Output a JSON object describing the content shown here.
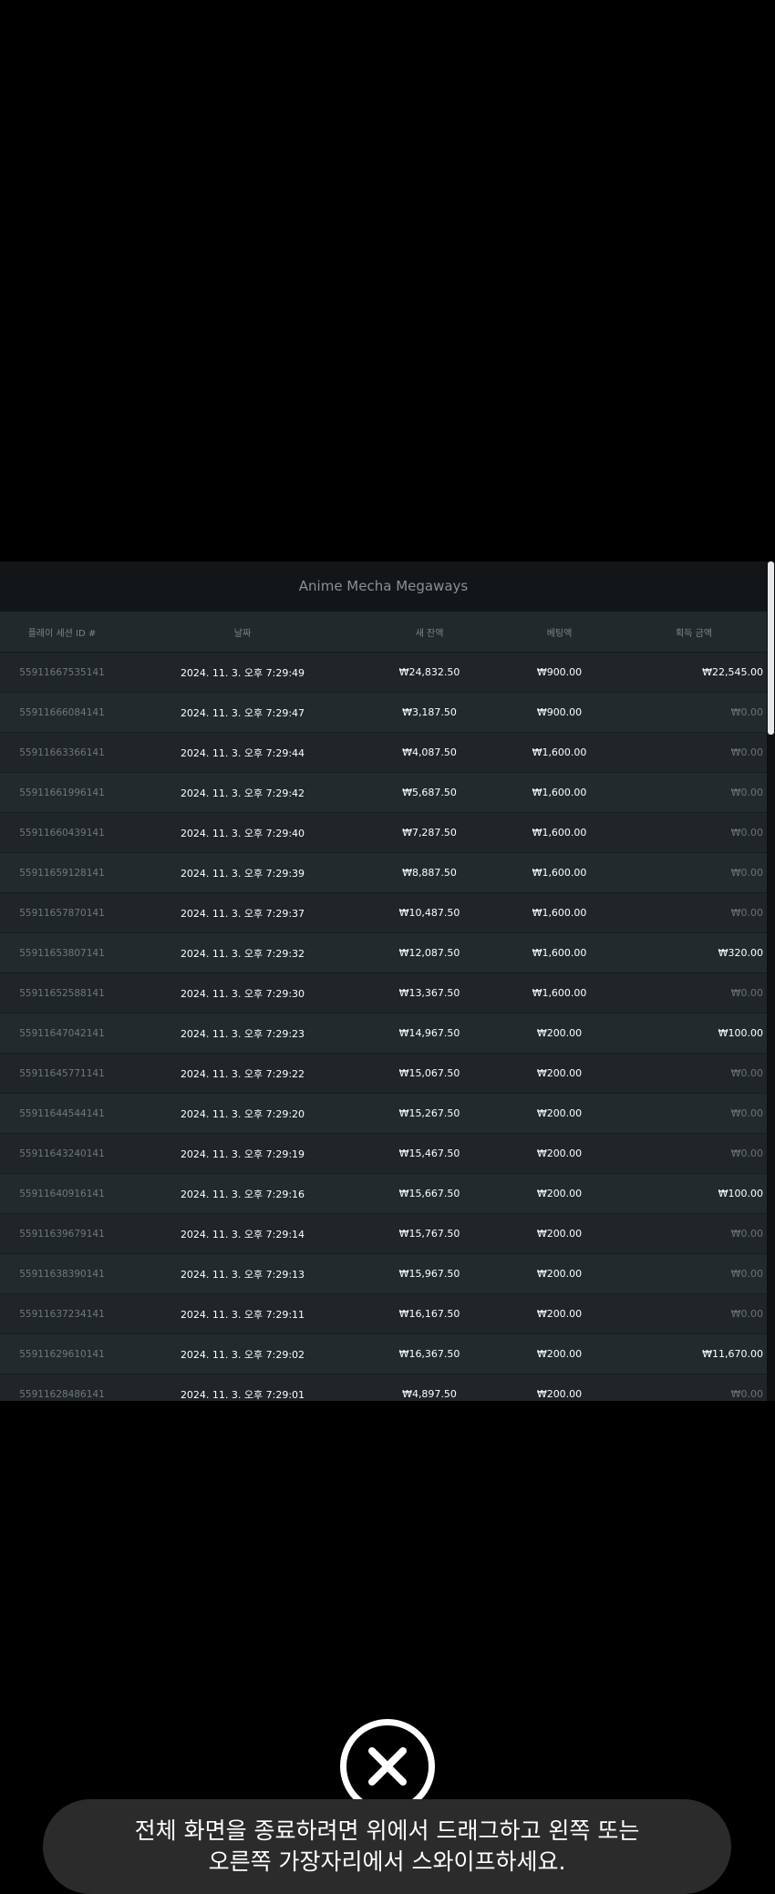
{
  "title": "Anime Mecha Megaways",
  "columns": [
    "플레이 세션 ID #",
    "날짜",
    "새 잔액",
    "베팅액",
    "획득 금액"
  ],
  "rows": [
    {
      "id": "55911667535141",
      "date": "2024. 11. 3. 오후 7:29:49",
      "balance": "₩24,832.50",
      "bet": "₩900.00",
      "win": "₩22,545.00"
    },
    {
      "id": "55911666084141",
      "date": "2024. 11. 3. 오후 7:29:47",
      "balance": "₩3,187.50",
      "bet": "₩900.00",
      "win": "₩0.00"
    },
    {
      "id": "55911663366141",
      "date": "2024. 11. 3. 오후 7:29:44",
      "balance": "₩4,087.50",
      "bet": "₩1,600.00",
      "win": "₩0.00"
    },
    {
      "id": "55911661996141",
      "date": "2024. 11. 3. 오후 7:29:42",
      "balance": "₩5,687.50",
      "bet": "₩1,600.00",
      "win": "₩0.00"
    },
    {
      "id": "55911660439141",
      "date": "2024. 11. 3. 오후 7:29:40",
      "balance": "₩7,287.50",
      "bet": "₩1,600.00",
      "win": "₩0.00"
    },
    {
      "id": "55911659128141",
      "date": "2024. 11. 3. 오후 7:29:39",
      "balance": "₩8,887.50",
      "bet": "₩1,600.00",
      "win": "₩0.00"
    },
    {
      "id": "55911657870141",
      "date": "2024. 11. 3. 오후 7:29:37",
      "balance": "₩10,487.50",
      "bet": "₩1,600.00",
      "win": "₩0.00"
    },
    {
      "id": "55911653807141",
      "date": "2024. 11. 3. 오후 7:29:32",
      "balance": "₩12,087.50",
      "bet": "₩1,600.00",
      "win": "₩320.00"
    },
    {
      "id": "55911652588141",
      "date": "2024. 11. 3. 오후 7:29:30",
      "balance": "₩13,367.50",
      "bet": "₩1,600.00",
      "win": "₩0.00"
    },
    {
      "id": "55911647042141",
      "date": "2024. 11. 3. 오후 7:29:23",
      "balance": "₩14,967.50",
      "bet": "₩200.00",
      "win": "₩100.00"
    },
    {
      "id": "55911645771141",
      "date": "2024. 11. 3. 오후 7:29:22",
      "balance": "₩15,067.50",
      "bet": "₩200.00",
      "win": "₩0.00"
    },
    {
      "id": "55911644544141",
      "date": "2024. 11. 3. 오후 7:29:20",
      "balance": "₩15,267.50",
      "bet": "₩200.00",
      "win": "₩0.00"
    },
    {
      "id": "55911643240141",
      "date": "2024. 11. 3. 오후 7:29:19",
      "balance": "₩15,467.50",
      "bet": "₩200.00",
      "win": "₩0.00"
    },
    {
      "id": "55911640916141",
      "date": "2024. 11. 3. 오후 7:29:16",
      "balance": "₩15,667.50",
      "bet": "₩200.00",
      "win": "₩100.00"
    },
    {
      "id": "55911639679141",
      "date": "2024. 11. 3. 오후 7:29:14",
      "balance": "₩15,767.50",
      "bet": "₩200.00",
      "win": "₩0.00"
    },
    {
      "id": "55911638390141",
      "date": "2024. 11. 3. 오후 7:29:13",
      "balance": "₩15,967.50",
      "bet": "₩200.00",
      "win": "₩0.00"
    },
    {
      "id": "55911637234141",
      "date": "2024. 11. 3. 오후 7:29:11",
      "balance": "₩16,167.50",
      "bet": "₩200.00",
      "win": "₩0.00"
    },
    {
      "id": "55911629610141",
      "date": "2024. 11. 3. 오후 7:29:02",
      "balance": "₩16,367.50",
      "bet": "₩200.00",
      "win": "₩11,670.00"
    },
    {
      "id": "55911628486141",
      "date": "2024. 11. 3. 오후 7:29:01",
      "balance": "₩4,897.50",
      "bet": "₩200.00",
      "win": "₩0.00"
    }
  ],
  "toast": {
    "line1": "전체 화면을 종료하려면 위에서 드래그하고 왼쪽 또는",
    "line2": "오른쪽 가장자리에서 스와이프하세요."
  },
  "colors": {
    "background": "#000000",
    "panel": "#1e2427",
    "title_bar": "#131618",
    "zero_win": "#6a7275",
    "toast_bg": "#2b2b2b"
  },
  "icons": {
    "close": "close-x-circle-icon"
  }
}
